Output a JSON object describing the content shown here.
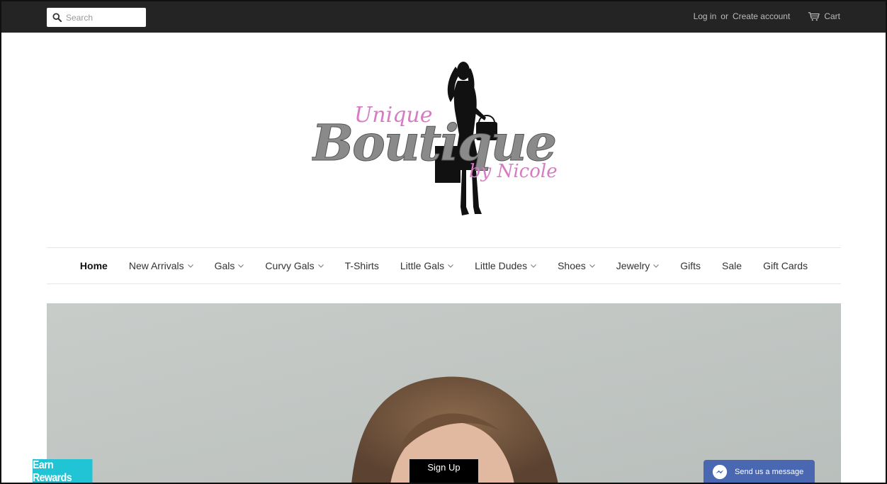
{
  "topbar": {
    "search_placeholder": "Search",
    "login_label": "Log in",
    "or_label": "or",
    "create_account_label": "Create account",
    "cart_label": "Cart"
  },
  "logo": {
    "line1": "Unique",
    "line2": "Boutique",
    "line3": "by Nicole"
  },
  "nav": {
    "items": [
      {
        "label": "Home",
        "active": true,
        "dropdown": false
      },
      {
        "label": "New Arrivals",
        "dropdown": true
      },
      {
        "label": "Gals",
        "dropdown": true
      },
      {
        "label": "Curvy Gals",
        "dropdown": true
      },
      {
        "label": "T-Shirts",
        "dropdown": false
      },
      {
        "label": "Little Gals",
        "dropdown": true
      },
      {
        "label": "Little Dudes",
        "dropdown": true
      },
      {
        "label": "Shoes",
        "dropdown": true
      },
      {
        "label": "Jewelry",
        "dropdown": true
      },
      {
        "label": "Gifts",
        "dropdown": false
      },
      {
        "label": "Sale",
        "dropdown": false
      },
      {
        "label": "Gift Cards",
        "dropdown": false
      }
    ]
  },
  "widgets": {
    "rewards_label": "Earn Rewards",
    "signup_label": "Sign Up",
    "messenger_label": "Send us a message"
  },
  "colors": {
    "topbar": "#242424",
    "rewards": "#21c4d5",
    "messenger": "#4a67b2",
    "logo_pink": "#d77bc4",
    "logo_gray": "#8a8a8a"
  }
}
